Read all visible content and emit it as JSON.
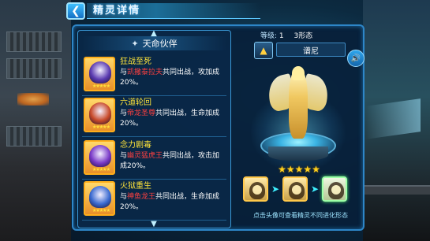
{
  "header": {
    "title": "精灵详情",
    "back_icon": "back-arrow-icon"
  },
  "partners": {
    "section_title": "天命伙伴",
    "scroll_up_icon": "chevron-up-icon",
    "scroll_down_icon": "chevron-down-icon",
    "items": [
      {
        "name": "狂战至死",
        "text_before": "与",
        "highlight": "凯撒泰拉夫",
        "text_after": "共同出战，攻加成20%。",
        "stars": "★★★★★",
        "portrait_color": "#5a3ab0"
      },
      {
        "name": "六道轮回",
        "text_before": "与",
        "highlight": "帝龙圣尊",
        "text_after": "共同出战，生命加成20%。",
        "stars": "★★★★★",
        "portrait_color": "#c84a2a"
      },
      {
        "name": "念力剧毒",
        "text_before": "与",
        "highlight": "幽灵猛虎王",
        "text_after": "共同出战，攻击加成20%。",
        "stars": "★★★★★",
        "portrait_color": "#7a3ac8"
      },
      {
        "name": "火狱重生",
        "text_before": "与",
        "highlight": "神鱼龙王",
        "text_after": "共同出战，生命加成20%。",
        "stars": "★★★★★",
        "portrait_color": "#3a6ad0"
      }
    ]
  },
  "spirit": {
    "level_label": "等级:",
    "level_value": "1",
    "form": "3形态",
    "name": "谱尼",
    "element_icon": "wing-element-icon",
    "voice_icon": "speaker-icon",
    "stars": "★★★★★",
    "evolution_stages": 3,
    "active_stage": 3,
    "tip": "点击头像可查看精灵不同进化形态"
  },
  "colors": {
    "accent": "#2d86c8",
    "highlight": "#ff4040",
    "skill_name": "#ffe43a",
    "star": "#ffd21e"
  }
}
